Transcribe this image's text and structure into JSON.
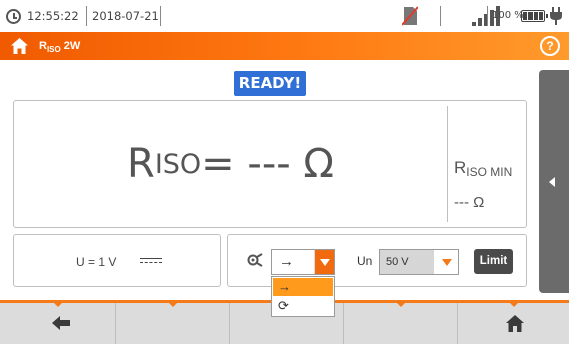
{
  "status": {
    "time": "12:55:22",
    "date": "2018-07-21",
    "battery_text": "100 %",
    "icons": [
      "clock-icon",
      "no-card-icon",
      "signal-icon",
      "battery-icon",
      "power-plug-icon"
    ]
  },
  "title_bar": {
    "title_main": "R",
    "title_sub": "ISO",
    "title_suffix": " 2W",
    "help_label": "?",
    "accent_color": "#f26a10"
  },
  "ready_label": "READY!",
  "result": {
    "symbol": "R",
    "symbol_sub": "ISO",
    "equals_value": " = --- Ω",
    "min_label": "R",
    "min_sub": "ISO MIN",
    "min_value": "--- Ω"
  },
  "voltage": {
    "label": "U = 1 V"
  },
  "controls": {
    "mode_value": "→",
    "mode_options": [
      "→",
      "⟳"
    ],
    "un_label": "Un",
    "un_value": "50 V",
    "limit_label": "Limit"
  },
  "toolbar": {
    "back_icon": "back-arrow-icon",
    "home_icon": "home-icon"
  }
}
